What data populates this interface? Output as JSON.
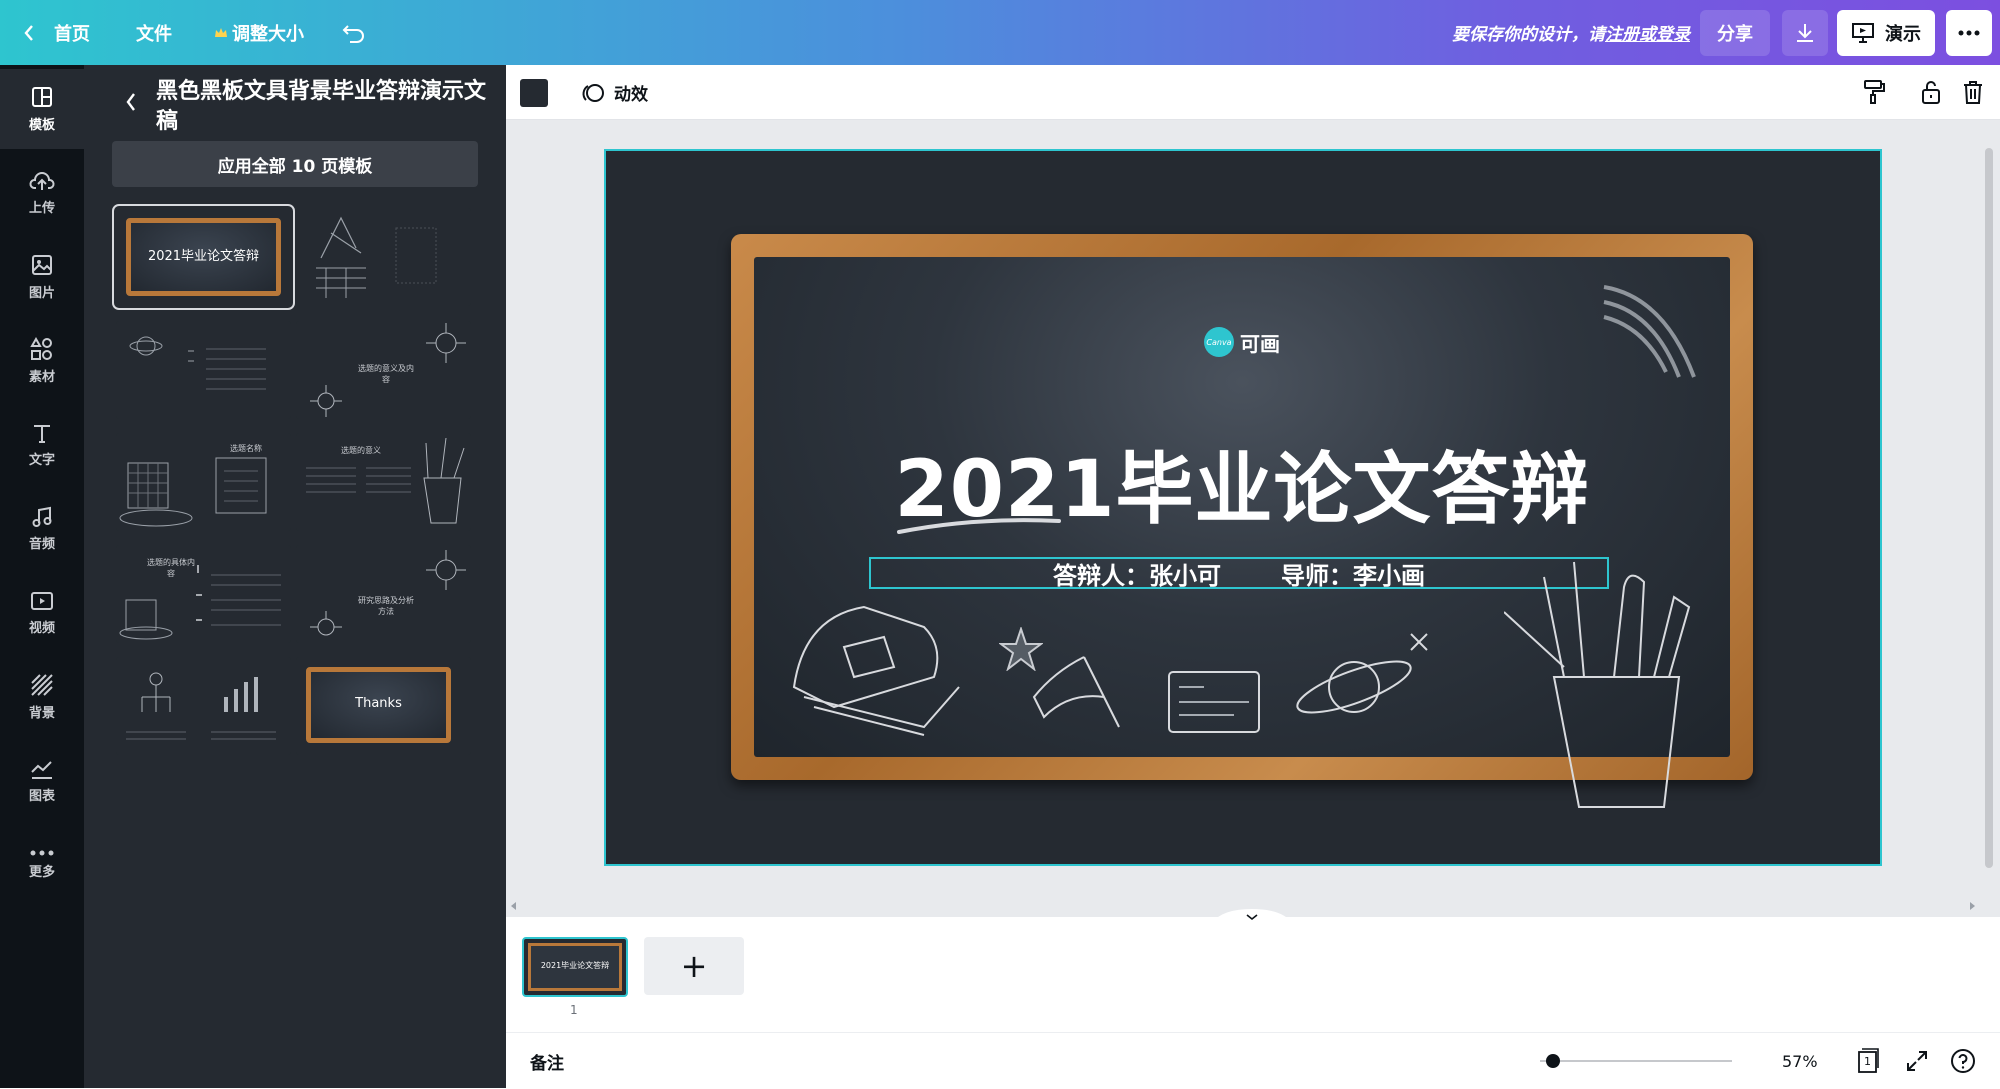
{
  "topbar": {
    "home": "首页",
    "file": "文件",
    "resize": "调整大小",
    "save_hint_pre": "要保存你的设计，请",
    "save_hint_link": "注册或登录",
    "share": "分享",
    "present": "演示"
  },
  "rail": {
    "items": [
      {
        "label": "模板",
        "icon": "template-icon"
      },
      {
        "label": "上传",
        "icon": "upload-cloud-icon"
      },
      {
        "label": "图片",
        "icon": "image-icon"
      },
      {
        "label": "素材",
        "icon": "elements-icon"
      },
      {
        "label": "文字",
        "icon": "text-icon"
      },
      {
        "label": "音频",
        "icon": "music-icon"
      },
      {
        "label": "视频",
        "icon": "video-icon"
      },
      {
        "label": "背景",
        "icon": "background-icon"
      },
      {
        "label": "图表",
        "icon": "chart-icon"
      },
      {
        "label": "更多",
        "icon": "more-dots-icon"
      }
    ]
  },
  "panel": {
    "title": "黑色黑板文具背景毕业答辩演示文稿",
    "apply_all": "应用全部 10 页模板",
    "thumbs": [
      {
        "text": "2021毕业论文答辩"
      },
      {
        "text": ""
      },
      {
        "text": ""
      },
      {
        "text": "选题的意义及内容"
      },
      {
        "text": "选题名称"
      },
      {
        "text": "选题的意义"
      },
      {
        "text": "选题的具体内容"
      },
      {
        "text": "研究思路及分析方法"
      },
      {
        "text": ""
      },
      {
        "text": "Thanks"
      }
    ]
  },
  "toolbar": {
    "animate": "动效"
  },
  "slide": {
    "logo_mark": "Canva",
    "logo_text": "可画",
    "title": "2021毕业论文答辩",
    "defender": "答辩人：张小可",
    "advisor": "导师：李小画"
  },
  "pages": {
    "page_number": "1",
    "thumb_title": "2021毕业论文答辩",
    "add": "+"
  },
  "bottom": {
    "notes": "备注",
    "zoom": "57%",
    "page_count": "1"
  },
  "colors": {
    "accent": "#2ec5cf",
    "board": "#2e353e",
    "frame": "#b8783a",
    "panel": "#252a31",
    "rail": "#0e1318"
  }
}
